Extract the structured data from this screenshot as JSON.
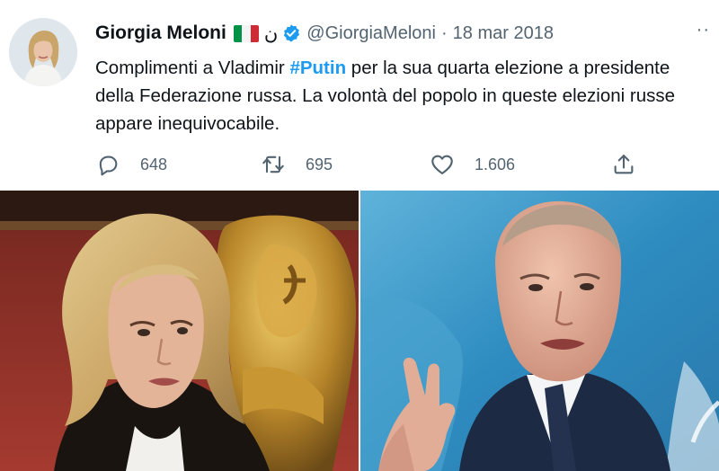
{
  "tweet": {
    "author_name": "Giorgia Meloni",
    "flag_icon": "italian-flag",
    "extra_glyph": "ن",
    "handle": "@GiorgiaMeloni",
    "separator": "·",
    "date": "18 mar 2018",
    "more_label": "··",
    "text_before": "Complimenti a Vladimir ",
    "hashtag": "#Putin",
    "text_after": " per la sua quarta elezione a presidente della Federazione russa. La volontà del popolo in queste elezioni russe appare inequivocabile.",
    "replies": "648",
    "retweets": "695",
    "likes": "1.606"
  },
  "colors": {
    "accent": "#1d9bf0",
    "secondary_text": "#536471",
    "primary_text": "#0f1419",
    "flag": [
      "#009246",
      "#ffffff",
      "#ce2b37"
    ]
  },
  "media": {
    "photos": [
      {
        "subject": "woman-portrait-photo"
      },
      {
        "subject": "man-portrait-photo"
      }
    ]
  }
}
